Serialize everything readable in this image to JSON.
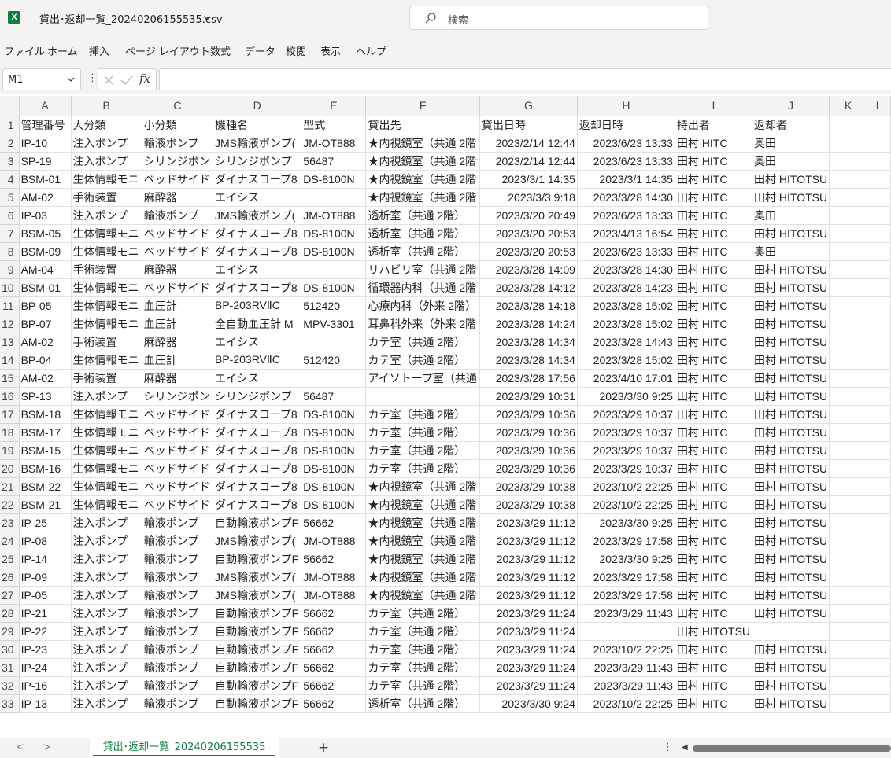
{
  "window": {
    "file_title": "貸出･返却一覧_20240206155535.csv",
    "app_icon": "X"
  },
  "search": {
    "placeholder": "検索"
  },
  "ribbon": {
    "tabs": [
      "ファイル",
      "ホーム",
      "挿入",
      "ページ レイアウト",
      "数式",
      "データ",
      "校閲",
      "表示",
      "ヘルプ"
    ]
  },
  "formula_bar": {
    "name_box": "M1",
    "dots": "⋮",
    "fx": "fx",
    "value": ""
  },
  "sheet": {
    "columns": [
      "A",
      "B",
      "C",
      "D",
      "E",
      "F",
      "G",
      "H",
      "I",
      "J",
      "K",
      "L"
    ],
    "rows": [
      [
        "管理番号",
        "大分類",
        "小分類",
        "機種名",
        "型式",
        "貸出先",
        "貸出日時",
        "返却日時",
        "持出者",
        "返却者",
        ""
      ],
      [
        "IP-10",
        "注入ポンプ",
        "輸液ポンプ",
        "JMS輸液ポンプ(",
        "JM-OT888",
        "★内視鏡室（共通 2階",
        "2023/2/14 12:44",
        "2023/6/23 13:33",
        "田村 HITC",
        "奥田",
        ""
      ],
      [
        "SP-19",
        "注入ポンプ",
        "シリンジポン",
        "シリンジポンプ",
        "56487",
        "★内視鏡室（共通 2階",
        "2023/2/14 12:44",
        "2023/6/23 13:33",
        "田村 HITC",
        "奥田",
        ""
      ],
      [
        "BSM-01",
        "生体情報モニ",
        "ベッドサイド",
        "ダイナスコープ8",
        "DS-8100N",
        "★内視鏡室（共通 2階",
        "2023/3/1 14:35",
        "2023/3/1 14:35",
        "田村 HITC",
        "田村 HITOTSU",
        ""
      ],
      [
        "AM-02",
        "手術装置",
        "麻酔器",
        "エイシス",
        "",
        "★内視鏡室（共通 2階",
        "2023/3/3 9:18",
        "2023/3/28 14:30",
        "田村 HITC",
        "田村 HITOTSU",
        ""
      ],
      [
        "IP-03",
        "注入ポンプ",
        "輸液ポンプ",
        "JMS輸液ポンプ(",
        "JM-OT888",
        "透析室（共通 2階）",
        "2023/3/20 20:49",
        "2023/6/23 13:33",
        "田村 HITC",
        "奥田",
        ""
      ],
      [
        "BSM-05",
        "生体情報モニ",
        "ベッドサイド",
        "ダイナスコープ8",
        "DS-8100N",
        "透析室（共通 2階）",
        "2023/3/20 20:53",
        "2023/4/13 16:54",
        "田村 HITC",
        "田村 HITOTSU",
        ""
      ],
      [
        "BSM-09",
        "生体情報モニ",
        "ベッドサイド",
        "ダイナスコープ8",
        "DS-8100N",
        "透析室（共通 2階）",
        "2023/3/20 20:53",
        "2023/6/23 13:33",
        "田村 HITC",
        "奥田",
        ""
      ],
      [
        "AM-04",
        "手術装置",
        "麻酔器",
        "エイシス",
        "",
        "リハビリ室（共通 2階",
        "2023/3/28 14:09",
        "2023/3/28 14:30",
        "田村 HITC",
        "田村 HITOTSU",
        ""
      ],
      [
        "BSM-01",
        "生体情報モニ",
        "ベッドサイド",
        "ダイナスコープ8",
        "DS-8100N",
        "循環器内科（共通 2階",
        "2023/3/28 14:12",
        "2023/3/28 14:23",
        "田村 HITC",
        "田村 HITOTSU",
        ""
      ],
      [
        "BP-05",
        "生体情報モニ",
        "血圧計",
        "BP-203RVⅡC",
        "512420",
        "心療内科（外来 2階）",
        "2023/3/28 14:18",
        "2023/3/28 15:02",
        "田村 HITC",
        "田村 HITOTSU",
        ""
      ],
      [
        "BP-07",
        "生体情報モニ",
        "血圧計",
        "全自動血圧計 M",
        "MPV-3301",
        "耳鼻科外来（外来 2階",
        "2023/3/28 14:24",
        "2023/3/28 15:02",
        "田村 HITC",
        "田村 HITOTSU",
        ""
      ],
      [
        "AM-02",
        "手術装置",
        "麻酔器",
        "エイシス",
        "",
        "カテ室（共通 2階）",
        "2023/3/28 14:34",
        "2023/3/28 14:43",
        "田村 HITC",
        "田村 HITOTSU",
        ""
      ],
      [
        "BP-04",
        "生体情報モニ",
        "血圧計",
        "BP-203RVⅡC",
        "512420",
        "カテ室（共通 2階）",
        "2023/3/28 14:34",
        "2023/3/28 15:02",
        "田村 HITC",
        "田村 HITOTSU",
        ""
      ],
      [
        "AM-02",
        "手術装置",
        "麻酔器",
        "エイシス",
        "",
        "アイソトープ室（共通",
        "2023/3/28 17:56",
        "2023/4/10 17:01",
        "田村 HITC",
        "田村 HITOTSU",
        ""
      ],
      [
        "SP-13",
        "注入ポンプ",
        "シリンジポン",
        "シリンジポンプ",
        "56487",
        "",
        "2023/3/29 10:31",
        "2023/3/30 9:25",
        "田村 HITC",
        "田村 HITOTSU",
        ""
      ],
      [
        "BSM-18",
        "生体情報モニ",
        "ベッドサイド",
        "ダイナスコープ8",
        "DS-8100N",
        "カテ室（共通 2階）",
        "2023/3/29 10:36",
        "2023/3/29 10:37",
        "田村 HITC",
        "田村 HITOTSU",
        ""
      ],
      [
        "BSM-17",
        "生体情報モニ",
        "ベッドサイド",
        "ダイナスコープ8",
        "DS-8100N",
        "カテ室（共通 2階）",
        "2023/3/29 10:36",
        "2023/3/29 10:37",
        "田村 HITC",
        "田村 HITOTSU",
        ""
      ],
      [
        "BSM-15",
        "生体情報モニ",
        "ベッドサイド",
        "ダイナスコープ8",
        "DS-8100N",
        "カテ室（共通 2階）",
        "2023/3/29 10:36",
        "2023/3/29 10:37",
        "田村 HITC",
        "田村 HITOTSU",
        ""
      ],
      [
        "BSM-16",
        "生体情報モニ",
        "ベッドサイド",
        "ダイナスコープ8",
        "DS-8100N",
        "カテ室（共通 2階）",
        "2023/3/29 10:36",
        "2023/3/29 10:37",
        "田村 HITC",
        "田村 HITOTSU",
        ""
      ],
      [
        "BSM-22",
        "生体情報モニ",
        "ベッドサイド",
        "ダイナスコープ8",
        "DS-8100N",
        "★内視鏡室（共通 2階",
        "2023/3/29 10:38",
        "2023/10/2 22:25",
        "田村 HITC",
        "田村 HITOTSU",
        ""
      ],
      [
        "BSM-21",
        "生体情報モニ",
        "ベッドサイド",
        "ダイナスコープ8",
        "DS-8100N",
        "★内視鏡室（共通 2階",
        "2023/3/29 10:38",
        "2023/10/2 22:25",
        "田村 HITC",
        "田村 HITOTSU",
        ""
      ],
      [
        "IP-25",
        "注入ポンプ",
        "輸液ポンプ",
        "自動輸液ポンプF",
        "56662",
        "★内視鏡室（共通 2階",
        "2023/3/29 11:12",
        "2023/3/30 9:25",
        "田村 HITC",
        "田村 HITOTSU",
        ""
      ],
      [
        "IP-08",
        "注入ポンプ",
        "輸液ポンプ",
        "JMS輸液ポンプ(",
        "JM-OT888",
        "★内視鏡室（共通 2階",
        "2023/3/29 11:12",
        "2023/3/29 17:58",
        "田村 HITC",
        "田村 HITOTSU",
        ""
      ],
      [
        "IP-14",
        "注入ポンプ",
        "輸液ポンプ",
        "自動輸液ポンプF",
        "56662",
        "★内視鏡室（共通 2階",
        "2023/3/29 11:12",
        "2023/3/30 9:25",
        "田村 HITC",
        "田村 HITOTSU",
        ""
      ],
      [
        "IP-09",
        "注入ポンプ",
        "輸液ポンプ",
        "JMS輸液ポンプ(",
        "JM-OT888",
        "★内視鏡室（共通 2階",
        "2023/3/29 11:12",
        "2023/3/29 17:58",
        "田村 HITC",
        "田村 HITOTSU",
        ""
      ],
      [
        "IP-05",
        "注入ポンプ",
        "輸液ポンプ",
        "JMS輸液ポンプ(",
        "JM-OT888",
        "★内視鏡室（共通 2階",
        "2023/3/29 11:12",
        "2023/3/29 17:58",
        "田村 HITC",
        "田村 HITOTSU",
        ""
      ],
      [
        "IP-21",
        "注入ポンプ",
        "輸液ポンプ",
        "自動輸液ポンプF",
        "56662",
        "カテ室（共通 2階）",
        "2023/3/29 11:24",
        "2023/3/29 11:43",
        "田村 HITC",
        "田村 HITOTSU",
        ""
      ],
      [
        "IP-22",
        "注入ポンプ",
        "輸液ポンプ",
        "自動輸液ポンプF",
        "56662",
        "カテ室（共通 2階）",
        "2023/3/29 11:24",
        "",
        "田村 HITOTSU",
        "",
        ""
      ],
      [
        "IP-23",
        "注入ポンプ",
        "輸液ポンプ",
        "自動輸液ポンプF",
        "56662",
        "カテ室（共通 2階）",
        "2023/3/29 11:24",
        "2023/10/2 22:25",
        "田村 HITC",
        "田村 HITOTSU",
        ""
      ],
      [
        "IP-24",
        "注入ポンプ",
        "輸液ポンプ",
        "自動輸液ポンプF",
        "56662",
        "カテ室（共通 2階）",
        "2023/3/29 11:24",
        "2023/3/29 11:43",
        "田村 HITC",
        "田村 HITOTSU",
        ""
      ],
      [
        "IP-16",
        "注入ポンプ",
        "輸液ポンプ",
        "自動輸液ポンプF",
        "56662",
        "カテ室（共通 2階）",
        "2023/3/29 11:24",
        "2023/3/29 11:43",
        "田村 HITC",
        "田村 HITOTSU",
        ""
      ],
      [
        "IP-13",
        "注入ポンプ",
        "輸液ポンプ",
        "自動輸液ポンプF",
        "56662",
        "透析室（共通 2階）",
        "2023/3/30 9:24",
        "2023/10/2 22:25",
        "田村 HITC",
        "田村 HITOTSU",
        ""
      ]
    ]
  },
  "bottom": {
    "prev": "<",
    "next": ">",
    "sheet_tab": "貸出･返却一覧_20240206155535",
    "add_sheet": "+",
    "menu": "⋮",
    "scroll_left": "◀"
  },
  "colors": {
    "accent": "#107c41",
    "chrome": "#f3f3f3"
  },
  "icons": {
    "search": "search-icon",
    "cancel": "cancel-icon",
    "confirm": "check-icon",
    "chevron": "chevron-down-icon"
  }
}
